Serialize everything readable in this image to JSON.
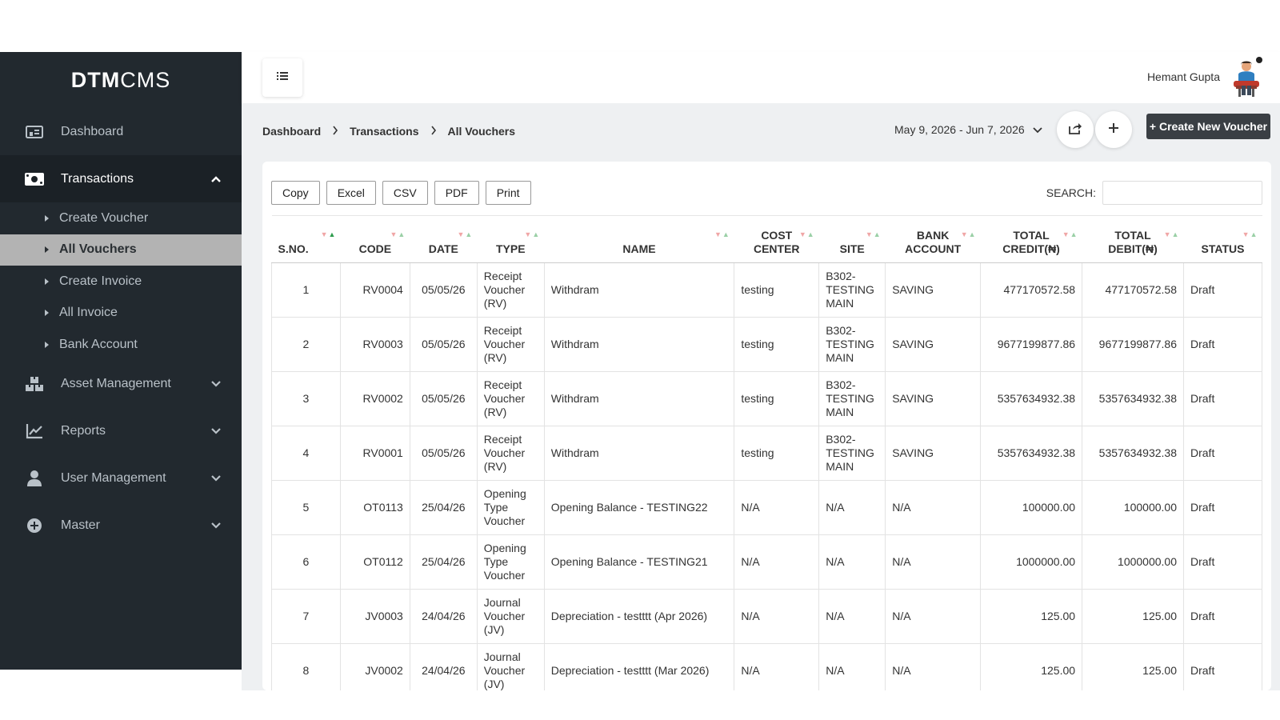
{
  "brand": {
    "part1": "DTM",
    "part2": "CMS"
  },
  "sidebar": {
    "items": [
      {
        "label": "Dashboard",
        "icon": "dashboard-icon"
      },
      {
        "label": "Transactions",
        "icon": "money-icon",
        "open": true,
        "subitems": [
          {
            "label": "Create Voucher"
          },
          {
            "label": "All Vouchers",
            "active": true
          },
          {
            "label": "Create Invoice"
          },
          {
            "label": "All Invoice"
          },
          {
            "label": "Bank Account"
          }
        ]
      },
      {
        "label": "Asset Management",
        "icon": "boxes-icon"
      },
      {
        "label": "Reports",
        "icon": "chart-line-icon"
      },
      {
        "label": "User Management",
        "icon": "user-icon"
      },
      {
        "label": "Master",
        "icon": "plus-circle-icon"
      }
    ]
  },
  "header": {
    "user_name": "Hemant Gupta"
  },
  "breadcrumb": [
    "Dashboard",
    "Transactions",
    "All Vouchers"
  ],
  "date_range": "May 9, 2026 - Jun 7, 2026",
  "create_button": "+ Create New Voucher",
  "export_buttons": [
    "Copy",
    "Excel",
    "CSV",
    "PDF",
    "Print"
  ],
  "search": {
    "label": "SEARCH:",
    "value": "",
    "placeholder": ""
  },
  "table": {
    "columns": [
      [
        "S.NO."
      ],
      [
        "CODE"
      ],
      [
        "DATE"
      ],
      [
        "TYPE"
      ],
      [
        "NAME"
      ],
      [
        "COST",
        "CENTER"
      ],
      [
        "SITE"
      ],
      [
        "BANK",
        "ACCOUNT"
      ],
      [
        "TOTAL",
        "CREDIT(₦)"
      ],
      [
        "TOTAL",
        "DEBIT(₦)"
      ],
      [
        "STATUS"
      ]
    ],
    "rows": [
      {
        "sno": "1",
        "code": "RV0004",
        "date": "05/05/26",
        "type": [
          "Receipt",
          "Voucher",
          "(RV)"
        ],
        "name": "Withdram",
        "cost_center": "testing",
        "site": [
          "B302-",
          "TESTING",
          "MAIN"
        ],
        "bank_account": "SAVING",
        "credit": "477170572.58",
        "debit": "477170572.58",
        "status": "Draft"
      },
      {
        "sno": "2",
        "code": "RV0003",
        "date": "05/05/26",
        "type": [
          "Receipt",
          "Voucher",
          "(RV)"
        ],
        "name": "Withdram",
        "cost_center": "testing",
        "site": [
          "B302-",
          "TESTING",
          "MAIN"
        ],
        "bank_account": "SAVING",
        "credit": "9677199877.86",
        "debit": "9677199877.86",
        "status": "Draft"
      },
      {
        "sno": "3",
        "code": "RV0002",
        "date": "05/05/26",
        "type": [
          "Receipt",
          "Voucher",
          "(RV)"
        ],
        "name": "Withdram",
        "cost_center": "testing",
        "site": [
          "B302-",
          "TESTING",
          "MAIN"
        ],
        "bank_account": "SAVING",
        "credit": "5357634932.38",
        "debit": "5357634932.38",
        "status": "Draft"
      },
      {
        "sno": "4",
        "code": "RV0001",
        "date": "05/05/26",
        "type": [
          "Receipt",
          "Voucher",
          "(RV)"
        ],
        "name": "Withdram",
        "cost_center": "testing",
        "site": [
          "B302-",
          "TESTING",
          "MAIN"
        ],
        "bank_account": "SAVING",
        "credit": "5357634932.38",
        "debit": "5357634932.38",
        "status": "Draft"
      },
      {
        "sno": "5",
        "code": "OT0113",
        "date": "25/04/26",
        "type": [
          "Opening",
          "Type",
          "Voucher"
        ],
        "name": "Opening Balance - TESTING22",
        "cost_center": "N/A",
        "site": [
          "N/A"
        ],
        "bank_account": "N/A",
        "credit": "100000.00",
        "debit": "100000.00",
        "status": "Draft"
      },
      {
        "sno": "6",
        "code": "OT0112",
        "date": "25/04/26",
        "type": [
          "Opening",
          "Type",
          "Voucher"
        ],
        "name": "Opening Balance - TESTING21",
        "cost_center": "N/A",
        "site": [
          "N/A"
        ],
        "bank_account": "N/A",
        "credit": "1000000.00",
        "debit": "1000000.00",
        "status": "Draft"
      },
      {
        "sno": "7",
        "code": "JV0003",
        "date": "24/04/26",
        "type": [
          "Journal",
          "Voucher",
          "(JV)"
        ],
        "name": "Depreciation - testttt (Apr 2026)",
        "cost_center": "N/A",
        "site": [
          "N/A"
        ],
        "bank_account": "N/A",
        "credit": "125.00",
        "debit": "125.00",
        "status": "Draft"
      },
      {
        "sno": "8",
        "code": "JV0002",
        "date": "24/04/26",
        "type": [
          "Journal",
          "Voucher",
          "(JV)"
        ],
        "name": "Depreciation - testttt (Mar 2026)",
        "cost_center": "N/A",
        "site": [
          "N/A"
        ],
        "bank_account": "N/A",
        "credit": "125.00",
        "debit": "125.00",
        "status": "Draft"
      }
    ]
  }
}
